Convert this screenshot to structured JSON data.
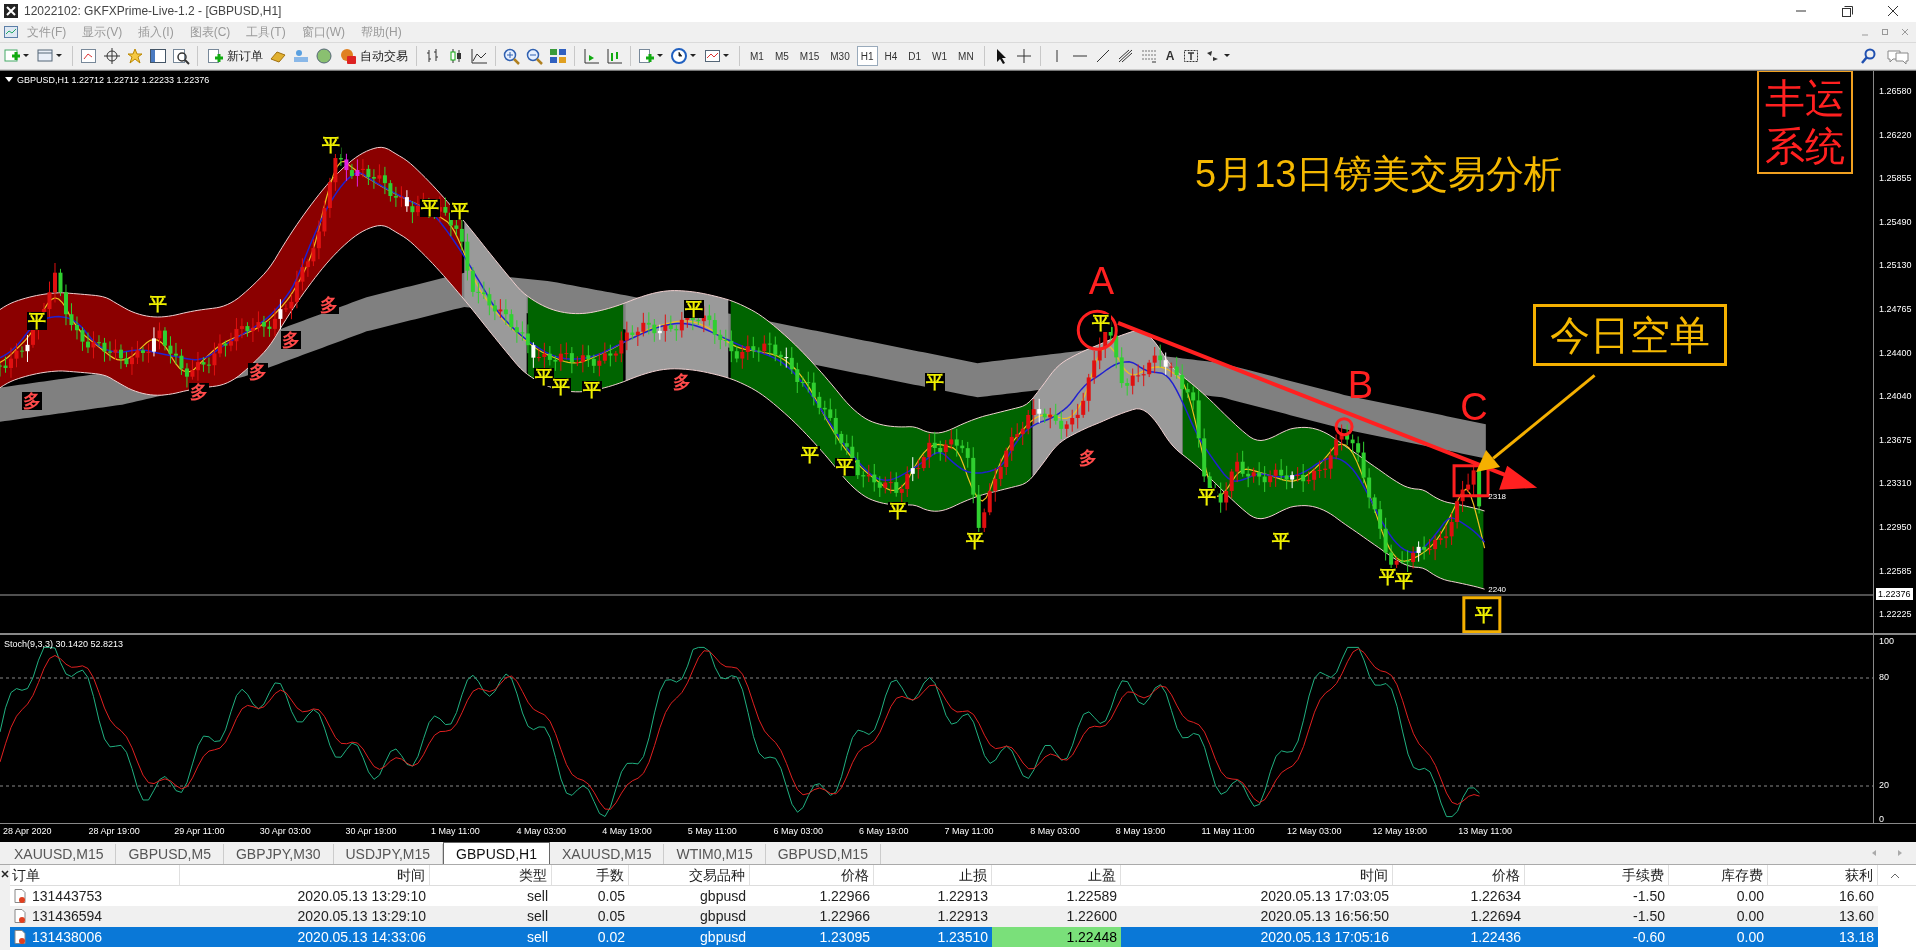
{
  "window": {
    "title": "12022102: GKFXPrime-Live-1.2 - [GBPUSD,H1]"
  },
  "menu": [
    {
      "label": "文件(F)"
    },
    {
      "label": "显示(V)"
    },
    {
      "label": "插入(I)"
    },
    {
      "label": "图表(C)"
    },
    {
      "label": "工具(T)"
    },
    {
      "label": "窗口(W)"
    },
    {
      "label": "帮助(H)"
    }
  ],
  "toolbar": {
    "new_order": "新订单",
    "auto_trading": "自动交易",
    "text_tool": "A",
    "timeframes": [
      {
        "label": "M1",
        "selected": false
      },
      {
        "label": "M5",
        "selected": false
      },
      {
        "label": "M15",
        "selected": false
      },
      {
        "label": "M30",
        "selected": false
      },
      {
        "label": "H1",
        "selected": true
      },
      {
        "label": "H4",
        "selected": false
      },
      {
        "label": "D1",
        "selected": false
      },
      {
        "label": "W1",
        "selected": false
      },
      {
        "label": "MN",
        "selected": false
      }
    ]
  },
  "chart": {
    "header": "GBPUSD,H1  1.22712 1.22712 1.22233 1.22376",
    "headline": "5月13日镑美交易分析",
    "badge": [
      "丰运",
      "系统"
    ],
    "points": [
      {
        "label": "A"
      },
      {
        "label": "B"
      },
      {
        "label": "C"
      }
    ],
    "callout": "今日空单",
    "signals": [
      {
        "kind": "exit",
        "label": "平"
      },
      {
        "kind": "exit",
        "label": "平"
      },
      {
        "kind": "exit",
        "label": "平"
      },
      {
        "kind": "exit",
        "label": "平"
      },
      {
        "kind": "exit",
        "label": "平"
      },
      {
        "kind": "exit",
        "label": "平"
      },
      {
        "kind": "exit",
        "label": "平"
      },
      {
        "kind": "exit",
        "label": "平"
      },
      {
        "kind": "exit",
        "label": "平"
      },
      {
        "kind": "exit",
        "label": "平"
      },
      {
        "kind": "exit",
        "label": "平"
      },
      {
        "kind": "exit",
        "label": "平"
      },
      {
        "kind": "exit",
        "label": "平"
      },
      {
        "kind": "exit",
        "label": "平"
      },
      {
        "kind": "exit",
        "label": "平"
      },
      {
        "kind": "exit",
        "label": "平"
      },
      {
        "kind": "exit",
        "label": "平"
      },
      {
        "kind": "exit",
        "label": "平"
      },
      {
        "kind": "exit",
        "label": "平"
      },
      {
        "kind": "exit",
        "label": "平"
      },
      {
        "kind": "long",
        "label": "多"
      },
      {
        "kind": "long",
        "label": "多"
      },
      {
        "kind": "long",
        "label": "多"
      },
      {
        "kind": "long",
        "label": "多"
      },
      {
        "kind": "long",
        "label": "多"
      },
      {
        "kind": "long",
        "label": "多"
      },
      {
        "kind": "long",
        "label": "多"
      }
    ],
    "line_labels": [
      "2318",
      "2240"
    ],
    "price_axis": [
      "1.26580",
      "1.26220",
      "1.25855",
      "1.25490",
      "1.25130",
      "1.24765",
      "1.24400",
      "1.24040",
      "1.23675",
      "1.23310",
      "1.22950",
      "1.22585",
      "1.22225"
    ],
    "current_price": "1.22376",
    "stoch_header": "Stoch(9,3,3) 30.1420 52.8213",
    "stoch_axis": [
      "100",
      "80",
      "20",
      "0"
    ],
    "time_axis": [
      "28 Apr 2020",
      "28 Apr 19:00",
      "29 Apr 11:00",
      "30 Apr 03:00",
      "30 Apr 19:00",
      "1 May 11:00",
      "4 May 03:00",
      "4 May 19:00",
      "5 May 11:00",
      "6 May 03:00",
      "6 May 19:00",
      "7 May 11:00",
      "8 May 03:00",
      "8 May 19:00",
      "11 May 11:00",
      "12 May 03:00",
      "12 May 19:00",
      "13 May 11:00"
    ]
  },
  "tabs": [
    {
      "label": "XAUUSD,M15",
      "selected": false
    },
    {
      "label": "GBPUSD,M5",
      "selected": false
    },
    {
      "label": "GBPJPY,M30",
      "selected": false
    },
    {
      "label": "USDJPY,M15",
      "selected": false
    },
    {
      "label": "GBPUSD,H1",
      "selected": true
    },
    {
      "label": "XAUUSD,M15",
      "selected": false
    },
    {
      "label": "WTIM0,M15",
      "selected": false
    },
    {
      "label": "GBPUSD,M15",
      "selected": false
    }
  ],
  "table": {
    "columns": [
      "订单",
      "时间",
      "类型",
      "手数",
      "交易品种",
      "价格",
      "止损",
      "止盈",
      "时间",
      "价格",
      "手续费",
      "库存费",
      "获利"
    ],
    "rows": [
      {
        "selected": false,
        "tp_hit": false,
        "cells": [
          "131443753",
          "2020.05.13 13:29:10",
          "sell",
          "0.05",
          "gbpusd",
          "1.22966",
          "1.22913",
          "1.22589",
          "2020.05.13 17:03:05",
          "1.22634",
          "-1.50",
          "0.00",
          "16.60"
        ]
      },
      {
        "selected": false,
        "tp_hit": false,
        "cells": [
          "131436594",
          "2020.05.13 13:29:10",
          "sell",
          "0.05",
          "gbpusd",
          "1.22966",
          "1.22913",
          "1.22600",
          "2020.05.13 16:56:50",
          "1.22694",
          "-1.50",
          "0.00",
          "13.60"
        ]
      },
      {
        "selected": true,
        "tp_hit": true,
        "cells": [
          "131438006",
          "2020.05.13 14:33:06",
          "sell",
          "0.02",
          "gbpusd",
          "1.23095",
          "1.23510",
          "1.22448",
          "2020.05.13 17:05:16",
          "1.22436",
          "-0.60",
          "0.00",
          "13.18"
        ]
      }
    ]
  }
}
